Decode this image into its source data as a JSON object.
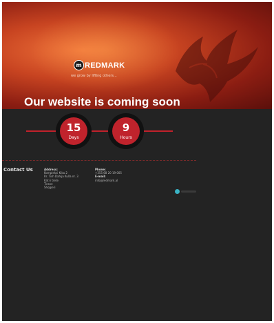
{
  "hero": {
    "logo_mark": "m",
    "logo_text": "REDMARK",
    "tagline": "we grow by lifting others...",
    "headline": "Our website is coming soon"
  },
  "countdown": [
    {
      "value": "15",
      "unit": "Days"
    },
    {
      "value": "9",
      "unit": "Hours"
    }
  ],
  "contact": {
    "title": "Contact Us",
    "address_label": "Address:",
    "address_lines": [
      "Kompleksi Kika 2",
      "Rr. Tish Dahija Kulla nr. 3",
      "Kati i trete",
      "Tirane",
      "Shqiperi"
    ],
    "phone_label": "Phone:",
    "phone": "+355 68 20 19 005",
    "email_label": "E-mail:",
    "email": "info@redmark.al"
  },
  "colors": {
    "accent": "#c0232c",
    "page_bg": "#232323",
    "social_dot": "#3ab3c4"
  },
  "icons": {
    "logo": "redmark-logo-icon",
    "phoenix": "phoenix-icon",
    "social": "social-dot-icon"
  }
}
